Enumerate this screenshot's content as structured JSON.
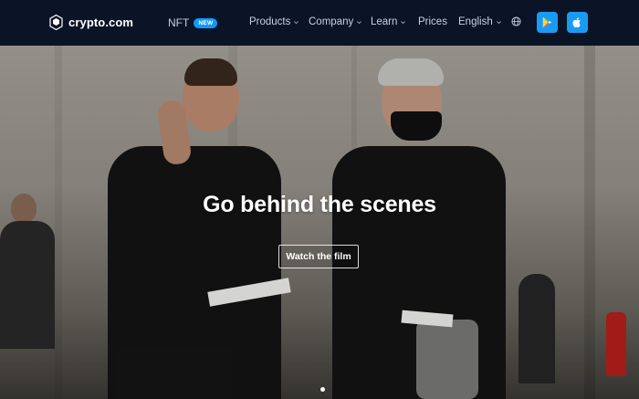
{
  "nav": {
    "logo_text": "crypto.com",
    "nft_label": "NFT",
    "nft_badge": "NEW",
    "products": "Products",
    "company": "Company",
    "learn": "Learn",
    "prices": "Prices",
    "language": "English"
  },
  "hero": {
    "title": "Go behind the scenes",
    "cta": "Watch the film",
    "slide_count": 1
  },
  "colors": {
    "nav_bg": "#0b1426",
    "accent": "#1199fa",
    "store_button": "#1a9bf3"
  }
}
